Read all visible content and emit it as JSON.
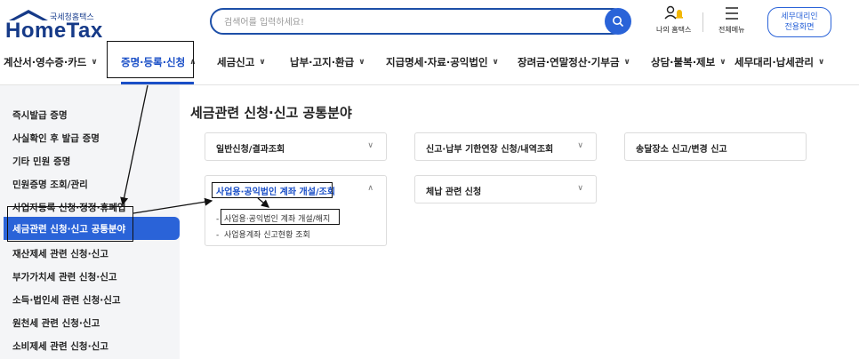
{
  "logo": {
    "subtitle": "국세청홈택스",
    "title": "HomeTax"
  },
  "search": {
    "placeholder": "검색어를 입력하세요!"
  },
  "header": {
    "my_hometax": "나의 홈택스",
    "all_menu": "전체메뉴",
    "tax_agent_line1": "세무대리인",
    "tax_agent_line2": "전용화면"
  },
  "nav": [
    {
      "label": "계산서·영수증·카드"
    },
    {
      "label": "증명·등록·신청"
    },
    {
      "label": "세금신고"
    },
    {
      "label": "납부·고지·환급"
    },
    {
      "label": "지급명세·자료·공익법인"
    },
    {
      "label": "장려금·연말정산·기부금"
    },
    {
      "label": "상담·불복·제보"
    },
    {
      "label": "세무대리·납세관리"
    }
  ],
  "sidebar": {
    "items": [
      {
        "label": "즉시발급 증명"
      },
      {
        "label": "사실확인 후 발급 증명"
      },
      {
        "label": "기타 민원 증명"
      },
      {
        "label": "민원증명 조회/관리"
      },
      {
        "label": "사업자등록 신청·정정·휴폐업"
      },
      {
        "label": "세금관련 신청·신고 공통분야"
      },
      {
        "label": "재산제세 관련 신청·신고"
      },
      {
        "label": "부가가치세 관련 신청·신고"
      },
      {
        "label": "소득·법인세 관련 신청·신고"
      },
      {
        "label": "원천세 관련 신청·신고"
      },
      {
        "label": "소비제세 관련 신청·신고"
      }
    ]
  },
  "main": {
    "title": "세금관련 신청·신고 공통분야",
    "cards": [
      {
        "label": "일반신청/결과조회"
      },
      {
        "label": "신고·납부 기한연장 신청/내역조회"
      },
      {
        "label": "송달장소 신고/변경 신고"
      },
      {
        "label": "사업용·공익법인 계좌 개설/조회"
      },
      {
        "label": "체납 관련 신청"
      }
    ],
    "sub_items": [
      {
        "label": "사업용·공익법인 계좌 개설/해지"
      },
      {
        "label": "사업용계좌 신고현황 조회"
      }
    ]
  },
  "colors": {
    "brand": "#163a88",
    "accent": "#2a63d8",
    "sidebar_bg": "#f4f5f7"
  },
  "icons": {
    "search": "search-icon",
    "my_hometax": "person-bell-icon",
    "menu": "hamburger-icon"
  }
}
